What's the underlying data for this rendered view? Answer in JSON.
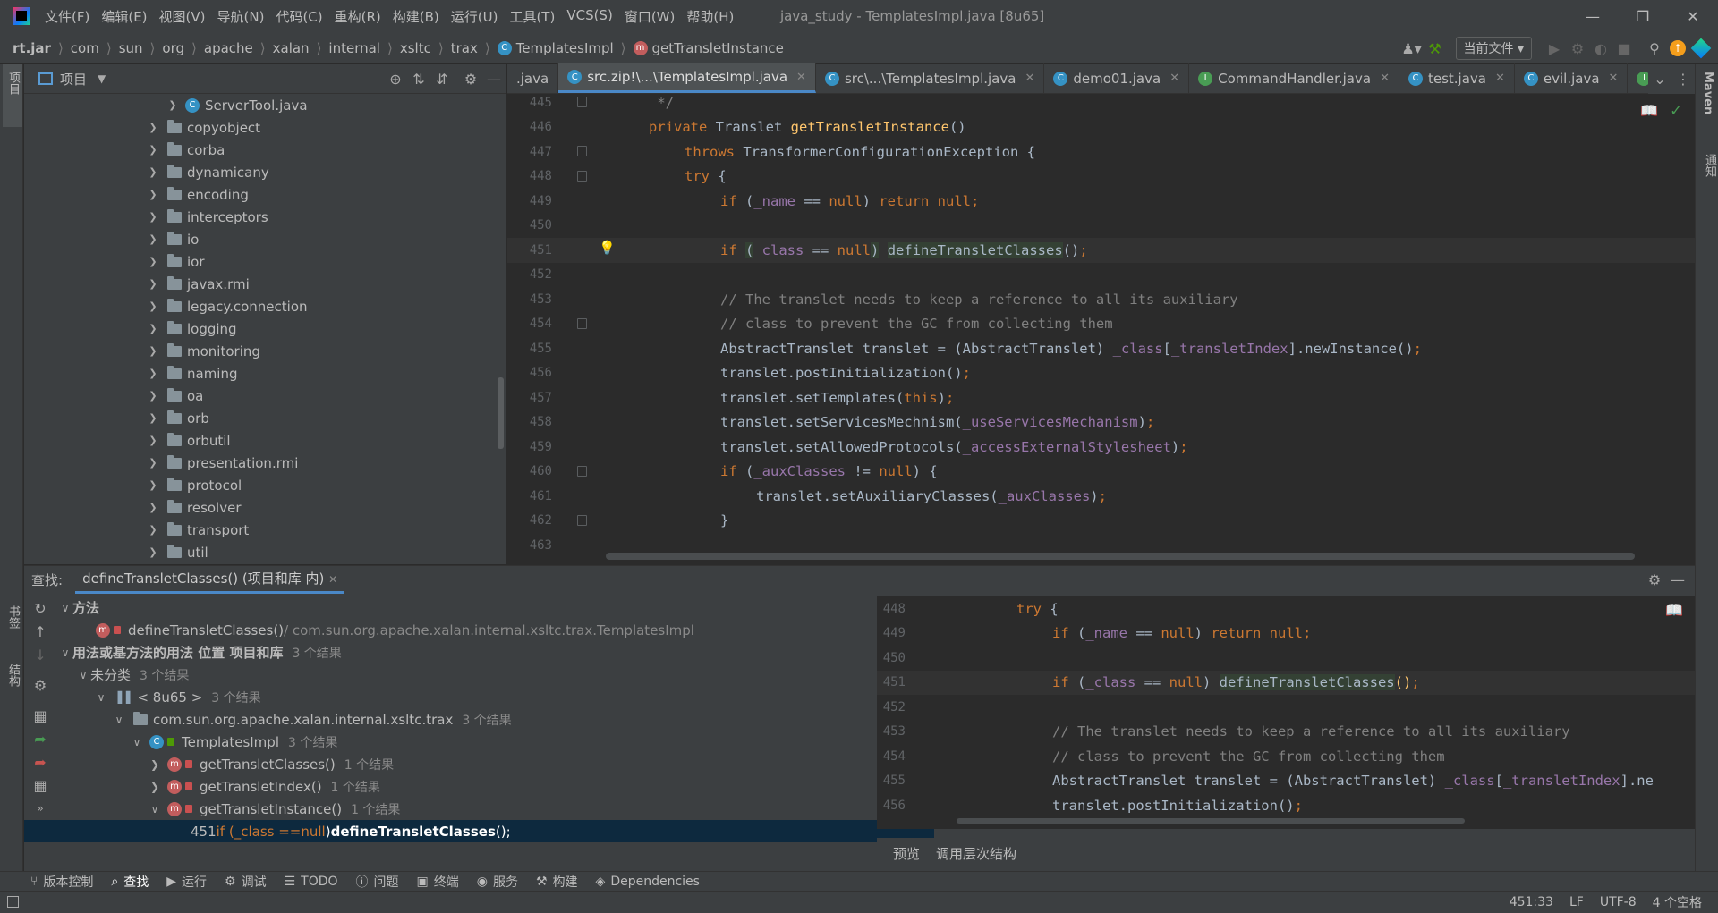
{
  "menu": [
    "文件(F)",
    "编辑(E)",
    "视图(V)",
    "导航(N)",
    "代码(C)",
    "重构(R)",
    "构建(B)",
    "运行(U)",
    "工具(T)",
    "VCS(S)",
    "窗口(W)",
    "帮助(H)"
  ],
  "window_title": "java_study - TemplatesImpl.java [8u65]",
  "breadcrumb": [
    "rt.jar",
    "com",
    "sun",
    "org",
    "apache",
    "xalan",
    "internal",
    "xsltc",
    "trax",
    "TemplatesImpl",
    "getTransletInstance"
  ],
  "run_config": "当前文件",
  "project_panel": {
    "title": "项目"
  },
  "left_strip": {
    "project": "项目",
    "bookmarks": "书签",
    "structure": "结构"
  },
  "right_strip": {
    "maven": "Maven",
    "notifications": "通知"
  },
  "project_tree": [
    {
      "label": "ServerTool.java",
      "type": "class",
      "depth": 2
    },
    {
      "label": "copyobject",
      "type": "folder",
      "depth": 1
    },
    {
      "label": "corba",
      "type": "folder",
      "depth": 1
    },
    {
      "label": "dynamicany",
      "type": "folder",
      "depth": 1
    },
    {
      "label": "encoding",
      "type": "folder",
      "depth": 1
    },
    {
      "label": "interceptors",
      "type": "folder",
      "depth": 1
    },
    {
      "label": "io",
      "type": "folder",
      "depth": 1
    },
    {
      "label": "ior",
      "type": "folder",
      "depth": 1
    },
    {
      "label": "javax.rmi",
      "type": "folder",
      "depth": 1
    },
    {
      "label": "legacy.connection",
      "type": "folder",
      "depth": 1
    },
    {
      "label": "logging",
      "type": "folder",
      "depth": 1
    },
    {
      "label": "monitoring",
      "type": "folder",
      "depth": 1
    },
    {
      "label": "naming",
      "type": "folder",
      "depth": 1
    },
    {
      "label": "oa",
      "type": "folder",
      "depth": 1
    },
    {
      "label": "orb",
      "type": "folder",
      "depth": 1
    },
    {
      "label": "orbutil",
      "type": "folder",
      "depth": 1
    },
    {
      "label": "presentation.rmi",
      "type": "folder",
      "depth": 1
    },
    {
      "label": "protocol",
      "type": "folder",
      "depth": 1
    },
    {
      "label": "resolver",
      "type": "folder",
      "depth": 1
    },
    {
      "label": "transport",
      "type": "folder",
      "depth": 1
    },
    {
      "label": "util",
      "type": "folder",
      "depth": 1
    }
  ],
  "editor_tabs": [
    {
      "label": ".java",
      "icon": "none",
      "active": false,
      "close": false
    },
    {
      "label": "src.zip!\\...\\TemplatesImpl.java",
      "icon": "class",
      "active": true,
      "close": true
    },
    {
      "label": "src\\...\\TemplatesImpl.java",
      "icon": "class",
      "active": false,
      "close": true
    },
    {
      "label": "demo01.java",
      "icon": "class",
      "active": false,
      "close": true
    },
    {
      "label": "CommandHandler.java",
      "icon": "interface",
      "active": false,
      "close": true
    },
    {
      "label": "test.java",
      "icon": "class",
      "active": false,
      "close": true
    },
    {
      "label": "evil.java",
      "icon": "class",
      "active": false,
      "close": true
    },
    {
      "label": "",
      "icon": "interface",
      "active": false,
      "close": false
    }
  ],
  "code_lines": [
    {
      "n": "445",
      "indent": 1,
      "tokens": [
        {
          "t": " */",
          "c": "cm"
        }
      ]
    },
    {
      "n": "446",
      "indent": 1,
      "tokens": [
        {
          "t": "private ",
          "c": "kw"
        },
        {
          "t": "Translet ",
          "c": "cls"
        },
        {
          "t": "getTransletInstance",
          "c": "fn"
        },
        {
          "t": "()",
          "c": "cls"
        }
      ]
    },
    {
      "n": "447",
      "indent": 2,
      "tokens": [
        {
          "t": "throws ",
          "c": "kw"
        },
        {
          "t": "TransformerConfigurationException {",
          "c": "cls"
        }
      ]
    },
    {
      "n": "448",
      "indent": 2,
      "tokens": [
        {
          "t": "try ",
          "c": "kw"
        },
        {
          "t": "{",
          "c": "cls"
        }
      ]
    },
    {
      "n": "449",
      "indent": 3,
      "tokens": [
        {
          "t": "if ",
          "c": "kw"
        },
        {
          "t": "(",
          "c": "cls"
        },
        {
          "t": "_name",
          "c": "fld"
        },
        {
          "t": " == ",
          "c": "cls"
        },
        {
          "t": "null",
          "c": "kw"
        },
        {
          "t": ") ",
          "c": "cls"
        },
        {
          "t": "return null",
          "c": "kw"
        },
        {
          "t": ";",
          "c": "kw"
        }
      ]
    },
    {
      "n": "450",
      "indent": 0,
      "tokens": []
    },
    {
      "n": "451",
      "indent": 3,
      "current": true,
      "bulb": true,
      "tokens": [
        {
          "t": "if ",
          "c": "kw"
        },
        {
          "t": "(",
          "c": "hl"
        },
        {
          "t": "_class",
          "c": "fld"
        },
        {
          "t": " == ",
          "c": "cls"
        },
        {
          "t": "null",
          "c": "kw"
        },
        {
          "t": ")",
          "c": "hl"
        },
        {
          "t": " ",
          "c": "cls"
        },
        {
          "t": "defineTransletClasses",
          "c": "hl"
        },
        {
          "t": "()",
          "c": "cls"
        },
        {
          "t": ";",
          "c": "kw"
        }
      ]
    },
    {
      "n": "452",
      "indent": 0,
      "tokens": []
    },
    {
      "n": "453",
      "indent": 3,
      "tokens": [
        {
          "t": "// The translet needs to keep a reference to all its auxiliary",
          "c": "cm"
        }
      ]
    },
    {
      "n": "454",
      "indent": 3,
      "tokens": [
        {
          "t": "// class to prevent the GC from collecting them",
          "c": "cm"
        }
      ]
    },
    {
      "n": "455",
      "indent": 3,
      "tokens": [
        {
          "t": "AbstractTranslet translet = (AbstractTranslet) ",
          "c": "cls"
        },
        {
          "t": "_class",
          "c": "fld"
        },
        {
          "t": "[",
          "c": "cls"
        },
        {
          "t": "_transletIndex",
          "c": "fld"
        },
        {
          "t": "].newInstance()",
          "c": "cls"
        },
        {
          "t": ";",
          "c": "kw"
        }
      ]
    },
    {
      "n": "456",
      "indent": 3,
      "tokens": [
        {
          "t": "translet.postInitialization()",
          "c": "cls"
        },
        {
          "t": ";",
          "c": "kw"
        }
      ]
    },
    {
      "n": "457",
      "indent": 3,
      "tokens": [
        {
          "t": "translet.setTemplates(",
          "c": "cls"
        },
        {
          "t": "this",
          "c": "kw"
        },
        {
          "t": ")",
          "c": "cls"
        },
        {
          "t": ";",
          "c": "kw"
        }
      ]
    },
    {
      "n": "458",
      "indent": 3,
      "tokens": [
        {
          "t": "translet.setServicesMechnism(",
          "c": "cls"
        },
        {
          "t": "_useServicesMechanism",
          "c": "fld"
        },
        {
          "t": ")",
          "c": "cls"
        },
        {
          "t": ";",
          "c": "kw"
        }
      ]
    },
    {
      "n": "459",
      "indent": 3,
      "tokens": [
        {
          "t": "translet.setAllowedProtocols(",
          "c": "cls"
        },
        {
          "t": "_accessExternalStylesheet",
          "c": "fld"
        },
        {
          "t": ")",
          "c": "cls"
        },
        {
          "t": ";",
          "c": "kw"
        }
      ]
    },
    {
      "n": "460",
      "indent": 3,
      "tokens": [
        {
          "t": "if ",
          "c": "kw"
        },
        {
          "t": "(",
          "c": "cls"
        },
        {
          "t": "_auxClasses",
          "c": "fld"
        },
        {
          "t": " != ",
          "c": "cls"
        },
        {
          "t": "null",
          "c": "kw"
        },
        {
          "t": ") {",
          "c": "cls"
        }
      ]
    },
    {
      "n": "461",
      "indent": 4,
      "tokens": [
        {
          "t": "translet.setAuxiliaryClasses(",
          "c": "cls"
        },
        {
          "t": "_auxClasses",
          "c": "fld"
        },
        {
          "t": ")",
          "c": "cls"
        },
        {
          "t": ";",
          "c": "kw"
        }
      ]
    },
    {
      "n": "462",
      "indent": 3,
      "tokens": [
        {
          "t": "}",
          "c": "cls"
        }
      ]
    },
    {
      "n": "463",
      "indent": 0,
      "tokens": []
    }
  ],
  "find": {
    "label": "查找:",
    "tab": "defineTransletClasses() (项目和库 内)",
    "rows": [
      {
        "depth": 0,
        "chev": "v",
        "bold": true,
        "label": "方法",
        "count": ""
      },
      {
        "depth": 1,
        "icon": "method",
        "label": "defineTransletClasses()",
        "suffix": " / com.sun.org.apache.xalan.internal.xsltc.trax.TemplatesImpl",
        "count": ""
      },
      {
        "depth": 0,
        "chev": "v",
        "bold": true,
        "label": "用法或基方法的用法 位置 项目和库",
        "count": "3 个结果"
      },
      {
        "depth": 1,
        "chev": "v",
        "label": "未分类",
        "count": "3 个结果"
      },
      {
        "depth": 2,
        "chev": "v",
        "icon": "lib",
        "label": "< 8u65 >",
        "count": "3 个结果"
      },
      {
        "depth": 3,
        "chev": "v",
        "icon": "pkg",
        "label": "com.sun.org.apache.xalan.internal.xsltc.trax",
        "count": "3 个结果"
      },
      {
        "depth": 4,
        "chev": "v",
        "icon": "class",
        "label": "TemplatesImpl",
        "count": "3 个结果"
      },
      {
        "depth": 5,
        "chev": ">",
        "icon": "method",
        "label": "getTransletClasses()",
        "count": "1 个结果"
      },
      {
        "depth": 5,
        "chev": ">",
        "icon": "method",
        "label": "getTransletIndex()",
        "count": "1 个结果"
      },
      {
        "depth": 5,
        "chev": "v",
        "icon": "method",
        "label": "getTransletInstance()",
        "count": "1 个结果"
      }
    ],
    "selected": {
      "line": "451",
      "pre": "if (_class == ",
      "null": "null",
      "mid": ") ",
      "call": "defineTransletClasses",
      "post": "();"
    }
  },
  "preview_lines": [
    {
      "n": "448",
      "indent": 2,
      "tokens": [
        {
          "t": "try ",
          "c": "kw"
        },
        {
          "t": "{",
          "c": "cls"
        }
      ]
    },
    {
      "n": "449",
      "indent": 3,
      "tokens": [
        {
          "t": "if ",
          "c": "kw"
        },
        {
          "t": "(",
          "c": "cls"
        },
        {
          "t": "_name",
          "c": "fld"
        },
        {
          "t": " == ",
          "c": "cls"
        },
        {
          "t": "null",
          "c": "kw"
        },
        {
          "t": ") ",
          "c": "cls"
        },
        {
          "t": "return null",
          "c": "kw"
        },
        {
          "t": ";",
          "c": "kw"
        }
      ]
    },
    {
      "n": "450",
      "indent": 0,
      "tokens": []
    },
    {
      "n": "451",
      "indent": 3,
      "current": true,
      "tokens": [
        {
          "t": "if ",
          "c": "kw"
        },
        {
          "t": "(",
          "c": "cls"
        },
        {
          "t": "_class",
          "c": "fld"
        },
        {
          "t": " == ",
          "c": "cls"
        },
        {
          "t": "null",
          "c": "kw"
        },
        {
          "t": ") ",
          "c": "cls"
        },
        {
          "t": "defineTransletClasses",
          "c": "hl"
        },
        {
          "t": "()",
          "c": "fn"
        },
        {
          "t": ";",
          "c": "kw"
        }
      ]
    },
    {
      "n": "452",
      "indent": 0,
      "tokens": []
    },
    {
      "n": "453",
      "indent": 3,
      "tokens": [
        {
          "t": "// The translet needs to keep a reference to all its auxiliary",
          "c": "cm"
        }
      ]
    },
    {
      "n": "454",
      "indent": 3,
      "tokens": [
        {
          "t": "// class to prevent the GC from collecting them",
          "c": "cm"
        }
      ]
    },
    {
      "n": "455",
      "indent": 3,
      "tokens": [
        {
          "t": "AbstractTranslet translet = (AbstractTranslet) ",
          "c": "cls"
        },
        {
          "t": "_class",
          "c": "fld"
        },
        {
          "t": "[",
          "c": "cls"
        },
        {
          "t": "_transletIndex",
          "c": "fld"
        },
        {
          "t": "].ne",
          "c": "cls"
        }
      ]
    },
    {
      "n": "456",
      "indent": 3,
      "tokens": [
        {
          "t": "translet.postInitialization()",
          "c": "cls"
        },
        {
          "t": ";",
          "c": "kw"
        }
      ]
    }
  ],
  "preview_tabs": [
    "预览",
    "调用层次结构"
  ],
  "bottom_tools": [
    {
      "label": "版本控制",
      "icon": "vcs-icon"
    },
    {
      "label": "查找",
      "icon": "search-icon",
      "active": true
    },
    {
      "label": "运行",
      "icon": "run-icon"
    },
    {
      "label": "调试",
      "icon": "debug-icon"
    },
    {
      "label": "TODO",
      "icon": "list-icon"
    },
    {
      "label": "问题",
      "icon": "problems-icon"
    },
    {
      "label": "终端",
      "icon": "terminal-icon"
    },
    {
      "label": "服务",
      "icon": "services-icon"
    },
    {
      "label": "构建",
      "icon": "build-icon"
    },
    {
      "label": "Dependencies",
      "icon": "dependencies-icon"
    }
  ],
  "status": {
    "position": "451:33",
    "line_sep": "LF",
    "encoding": "UTF-8",
    "indent": "4 个空格"
  },
  "colors": {
    "keyword": "#cc7832",
    "field": "#9876aa",
    "method": "#ffc66d",
    "comment": "#808080",
    "accent": "#4a88c7"
  }
}
